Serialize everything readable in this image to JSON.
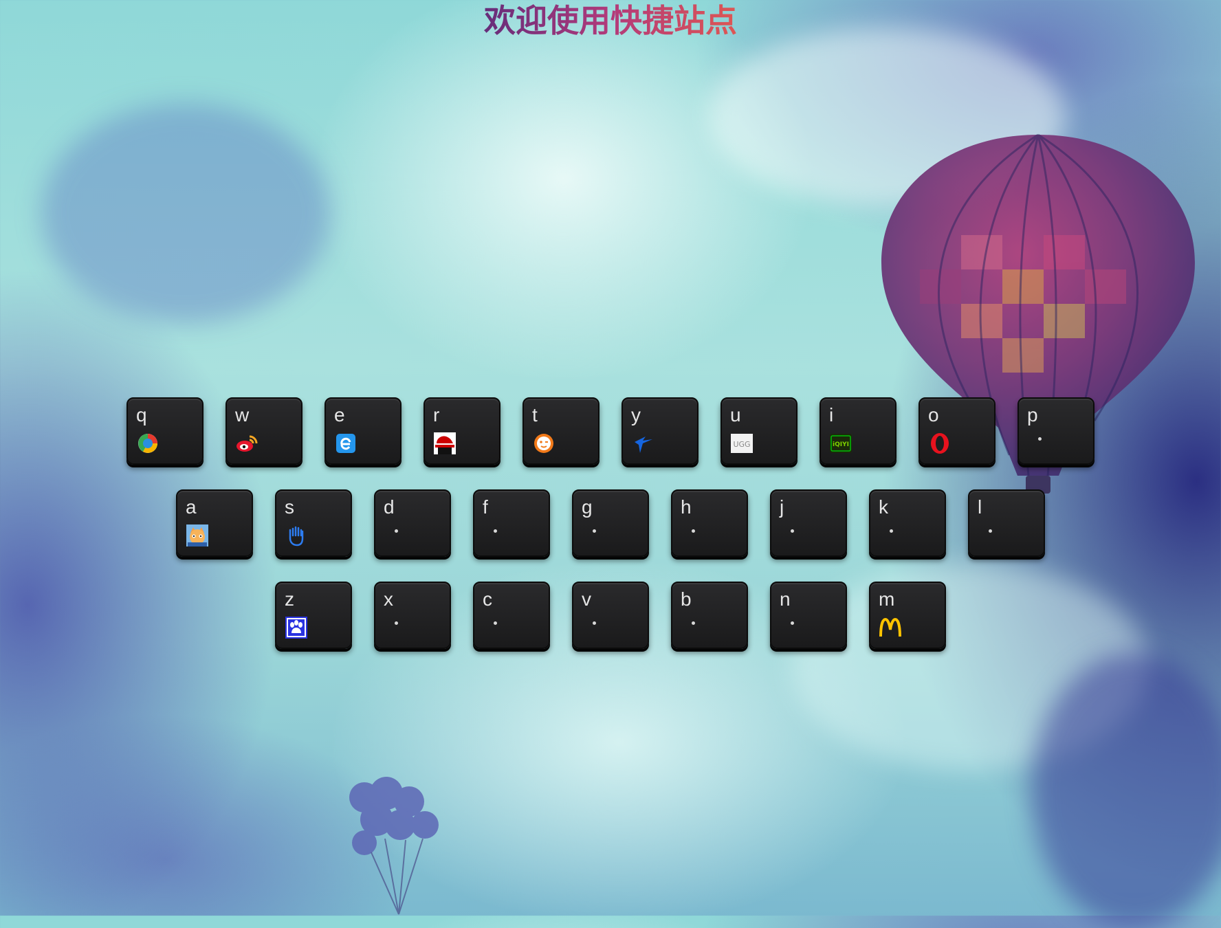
{
  "page": {
    "title": "欢迎使用快捷站点"
  },
  "keyboard": {
    "rows": [
      [
        {
          "letter": "q",
          "icon": "tencent-qq-browser-icon"
        },
        {
          "letter": "w",
          "icon": "weibo-icon"
        },
        {
          "letter": "e",
          "icon": "ie-browser-icon"
        },
        {
          "letter": "r",
          "icon": "redhat-icon"
        },
        {
          "letter": "t",
          "icon": "tiktok-mascot-icon"
        },
        {
          "letter": "y",
          "icon": "airline-arrow-icon"
        },
        {
          "letter": "u",
          "icon": "ugg-logo-icon",
          "icon_text": "UGG"
        },
        {
          "letter": "i",
          "icon": "iqiyi-logo-icon",
          "icon_text": "iQIYI"
        },
        {
          "letter": "o",
          "icon": "opera-icon"
        },
        {
          "letter": "p",
          "icon": "dot-placeholder-icon"
        }
      ],
      [
        {
          "letter": "a",
          "icon": "anime-cat-icon"
        },
        {
          "letter": "s",
          "icon": "glove-hand-icon"
        },
        {
          "letter": "d",
          "icon": "dot-placeholder-icon"
        },
        {
          "letter": "f",
          "icon": "dot-placeholder-icon"
        },
        {
          "letter": "g",
          "icon": "dot-placeholder-icon"
        },
        {
          "letter": "h",
          "icon": "dot-placeholder-icon"
        },
        {
          "letter": "j",
          "icon": "dot-placeholder-icon"
        },
        {
          "letter": "k",
          "icon": "dot-placeholder-icon"
        },
        {
          "letter": "l",
          "icon": "dot-placeholder-icon"
        }
      ],
      [
        {
          "letter": "z",
          "icon": "baidu-paw-icon"
        },
        {
          "letter": "x",
          "icon": "dot-placeholder-icon"
        },
        {
          "letter": "c",
          "icon": "dot-placeholder-icon"
        },
        {
          "letter": "v",
          "icon": "dot-placeholder-icon"
        },
        {
          "letter": "b",
          "icon": "dot-placeholder-icon"
        },
        {
          "letter": "n",
          "icon": "dot-placeholder-icon"
        },
        {
          "letter": "m",
          "icon": "mcdonalds-icon"
        }
      ]
    ]
  },
  "colors": {
    "title_gradient": [
      "#5b2b7a",
      "#b23a7a",
      "#e45a4e"
    ],
    "key_background": "#1e1e1f",
    "key_text": "#e6e6e6"
  }
}
